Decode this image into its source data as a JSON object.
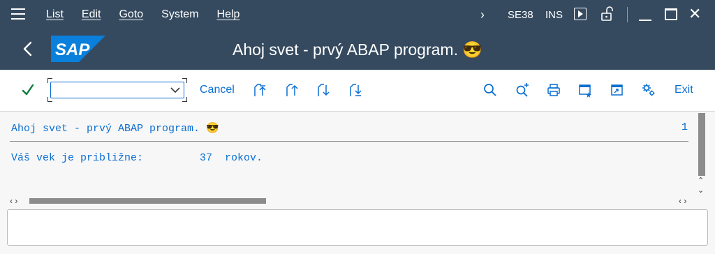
{
  "menubar": {
    "items": [
      "List",
      "Edit",
      "Goto",
      "System",
      "Help"
    ],
    "tcode": "SE38",
    "mode": "INS"
  },
  "titlebar": {
    "title": "Ahoj svet - prvý ABAP program. 😎",
    "logo_text": "SAP"
  },
  "toolbar": {
    "command_value": "",
    "cancel_label": "Cancel",
    "exit_label": "Exit"
  },
  "list": {
    "header_title": "Ahoj svet - prvý ABAP program. 😎",
    "page_number": "1",
    "line1": "Váš vek je približne:         37  rokov."
  },
  "statusbar": {
    "message": ""
  },
  "colors": {
    "shell": "#354a5f",
    "accent": "#0a6ed1",
    "ok_green": "#107e3e"
  }
}
